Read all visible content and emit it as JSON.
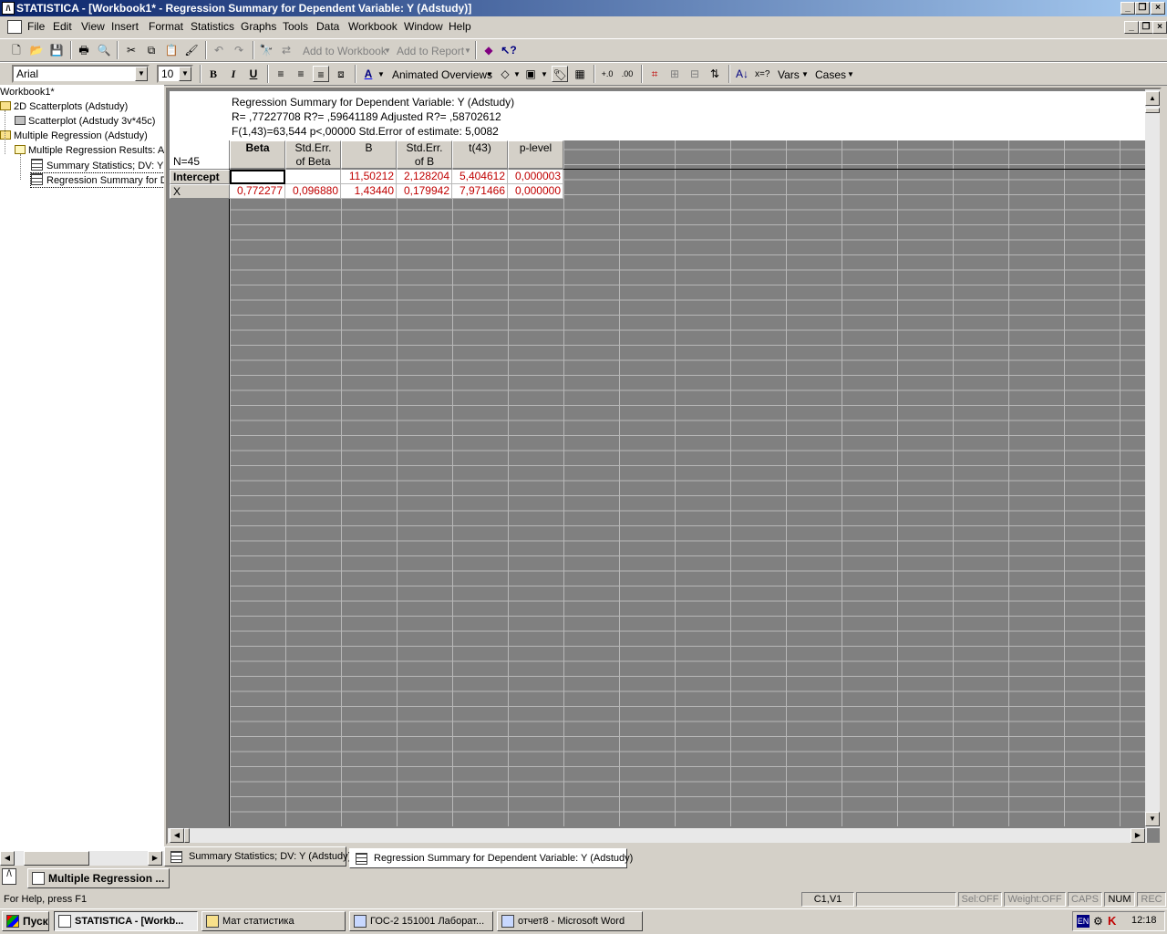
{
  "window": {
    "title": "STATISTICA - [Workbook1* - Regression Summary for Dependent Variable: Y (Adstudy)]"
  },
  "menu": [
    "File",
    "Edit",
    "View",
    "Insert",
    "Format",
    "Statistics",
    "Graphs",
    "Tools",
    "Data",
    "Workbook",
    "Window",
    "Help"
  ],
  "toolbar": {
    "add_to_workbook": "Add to Workbook",
    "add_to_report": "Add to Report",
    "font_name": "Arial",
    "font_size": "10",
    "bold": "B",
    "italic": "I",
    "underline": "U",
    "animated_overviews": "Animated Overviews",
    "x_equals": "x=?",
    "vars": "Vars",
    "cases": "Cases"
  },
  "tree": {
    "root": "Workbook1*",
    "items": [
      "2D Scatterplots (Adstudy)",
      "Scatterplot (Adstudy 3v*45c)",
      "Multiple Regression (Adstudy)",
      "Multiple Regression Results: A",
      "Summary Statistics; DV: Y",
      "Regression Summary for D"
    ]
  },
  "sheet": {
    "header_lines": [
      "Regression Summary for Dependent Variable: Y (Adstudy)",
      "R= ,77227708 R?= ,59641189 Adjusted R?= ,58702612",
      "F(1,43)=63,544 p<,00000 Std.Error of estimate: 5,0082"
    ],
    "n_label": "N=45",
    "columns": [
      {
        "line1": "Beta",
        "line2": ""
      },
      {
        "line1": "Std.Err.",
        "line2": "of Beta"
      },
      {
        "line1": "B",
        "line2": ""
      },
      {
        "line1": "Std.Err.",
        "line2": "of B"
      },
      {
        "line1": "t(43)",
        "line2": ""
      },
      {
        "line1": "p-level",
        "line2": ""
      }
    ],
    "rows": [
      {
        "label": "Intercept",
        "cells": [
          "",
          "",
          "11,50212",
          "2,128204",
          "5,404612",
          "0,000003"
        ]
      },
      {
        "label": "X",
        "cells": [
          "0,772277",
          "0,096880",
          "1,43440",
          "0,179942",
          "7,971466",
          "0,000000"
        ]
      }
    ]
  },
  "tabs": [
    "Summary Statistics; DV: Y (Adstudy)",
    "Regression Summary for Dependent Variable: Y (Adstudy)"
  ],
  "minimized_window": "Multiple Regression ...",
  "status": {
    "help": "For Help, press F1",
    "cell_ref": "C1,V1",
    "sel": "Sel:OFF",
    "weight": "Weight:OFF",
    "caps": "CAPS",
    "num": "NUM",
    "rec": "REC"
  },
  "taskbar": {
    "start": "Пуск",
    "items": [
      "STATISTICA - [Workb...",
      "Мат статистика",
      "ГОС-2 151001 Лаборат...",
      "отчет8 - Microsoft Word"
    ],
    "lang": "EN",
    "clock": "12:18"
  },
  "colors": {
    "value_red": "#c00000",
    "title_blue": "#0a246a",
    "sheet_gray": "#808080"
  }
}
